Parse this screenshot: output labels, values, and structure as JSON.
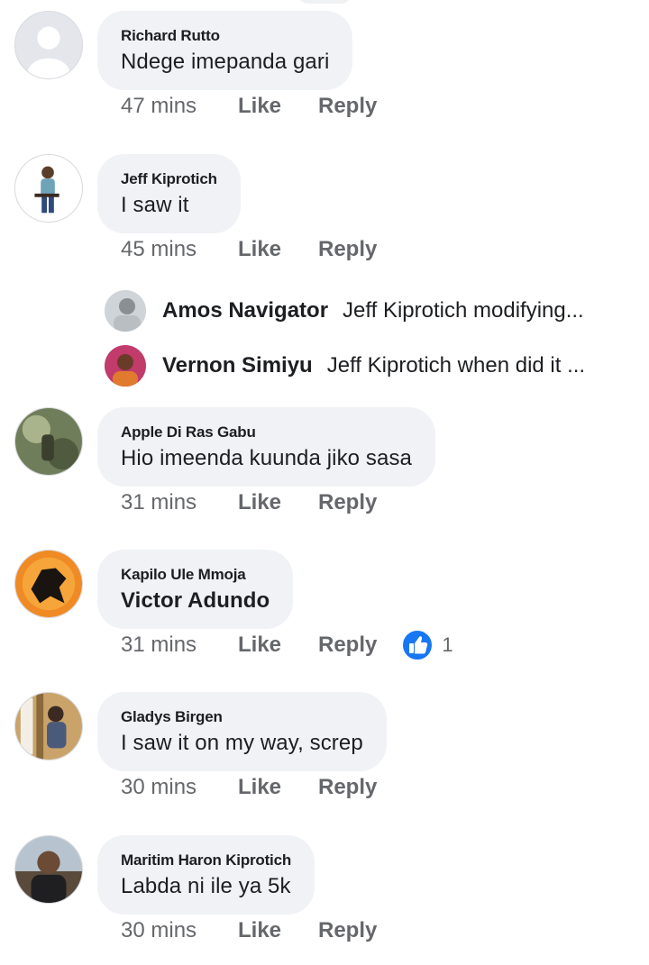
{
  "comments": [
    {
      "author": "Richard Rutto",
      "text": "Ndege imepanda gari",
      "time": "47 mins",
      "like": "Like",
      "reply": "Reply"
    },
    {
      "author": "Jeff Kiprotich",
      "text": "I saw it",
      "time": "45 mins",
      "like": "Like",
      "reply": "Reply",
      "replies": [
        {
          "name": "Amos Navigator",
          "snippet": "Jeff Kiprotich modifying..."
        },
        {
          "name": "Vernon Simiyu",
          "snippet": "Jeff Kiprotich when did it ..."
        }
      ]
    },
    {
      "author": "Apple Di Ras Gabu",
      "text": "Hio imeenda kuunda jiko sasa",
      "time": "31 mins",
      "like": "Like",
      "reply": "Reply"
    },
    {
      "author": "Kapilo Ule Mmoja",
      "text": "Victor Adundo",
      "time": "31 mins",
      "like": "Like",
      "reply": "Reply",
      "reaction": {
        "icon": "thumbs-up-icon",
        "count": "1",
        "color": "#1877f2"
      }
    },
    {
      "author": "Gladys Birgen",
      "text": "I saw it on my way, screp",
      "time": "30 mins",
      "like": "Like",
      "reply": "Reply"
    },
    {
      "author": "Maritim Haron Kiprotich",
      "text": "Labda ni ile ya 5k",
      "time": "30 mins",
      "like": "Like",
      "reply": "Reply"
    }
  ],
  "colors": {
    "bubble": "#f0f2f5",
    "text": "#1c1e21",
    "meta": "#65676b",
    "like_blue": "#1877f2"
  }
}
